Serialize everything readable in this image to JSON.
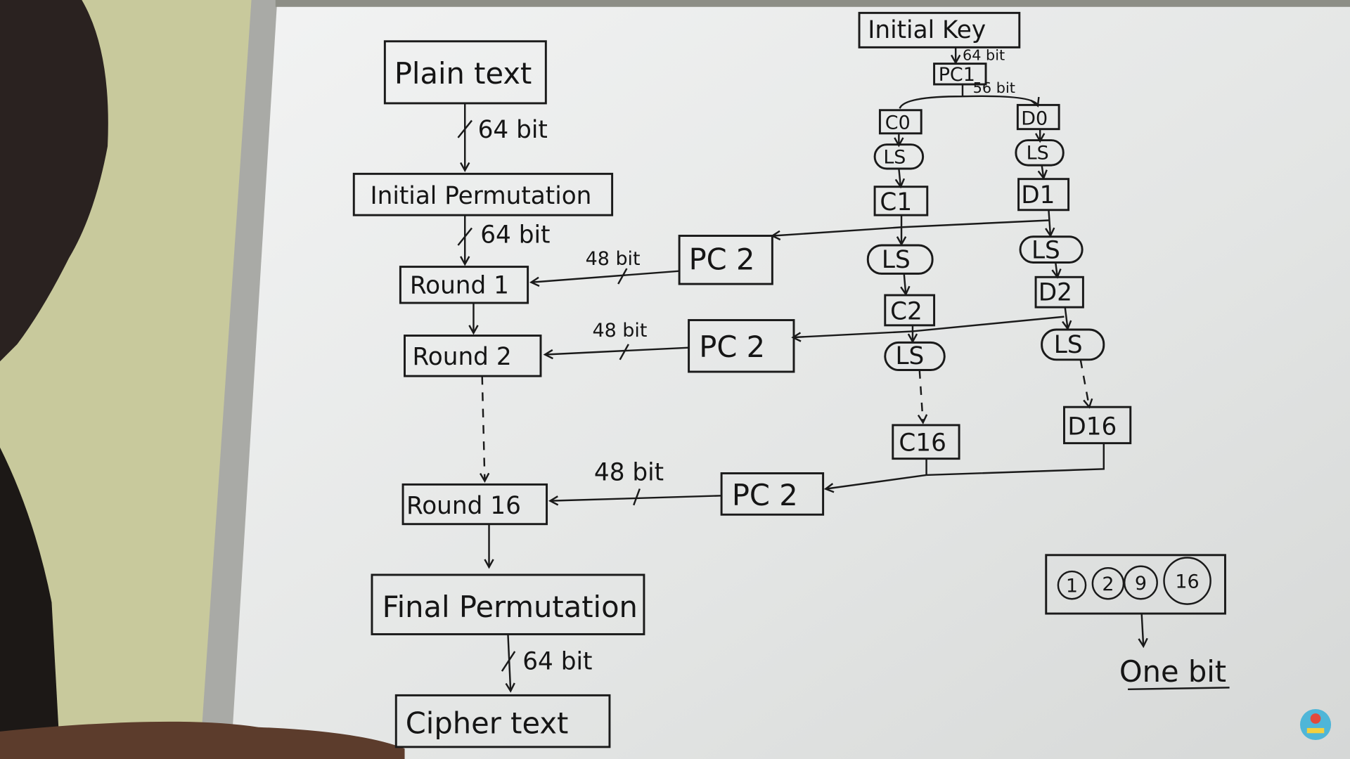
{
  "title": "DES encryption diagram on whiteboard",
  "data_path": {
    "plain_text": "Plain text",
    "initial_permutation": "Initial Permutation",
    "round_1": "Round 1",
    "round_2": "Round 2",
    "round_16": "Round 16",
    "final_permutation": "Final Permutation",
    "cipher_text": "Cipher text",
    "bits_64": "64 bit",
    "bits_48": "48 bit"
  },
  "key_schedule": {
    "initial_key": "Initial Key",
    "pc1": "PC1",
    "pc2": "PC 2",
    "bits_64": "64 bit",
    "bits_56": "56 bit",
    "left_halves": [
      "C0",
      "C1",
      "C2",
      "C16"
    ],
    "right_halves": [
      "D0",
      "D1",
      "D2",
      "D16"
    ],
    "left_shift": "LS"
  },
  "shift_note": {
    "rounds": [
      "1",
      "2",
      "9",
      "16"
    ],
    "label": "One bit"
  },
  "colors": {
    "board": "#e6e8e6",
    "wall": "#c9c9a0",
    "ink": "#1a1a1a",
    "frame": "#a8a8a8"
  }
}
